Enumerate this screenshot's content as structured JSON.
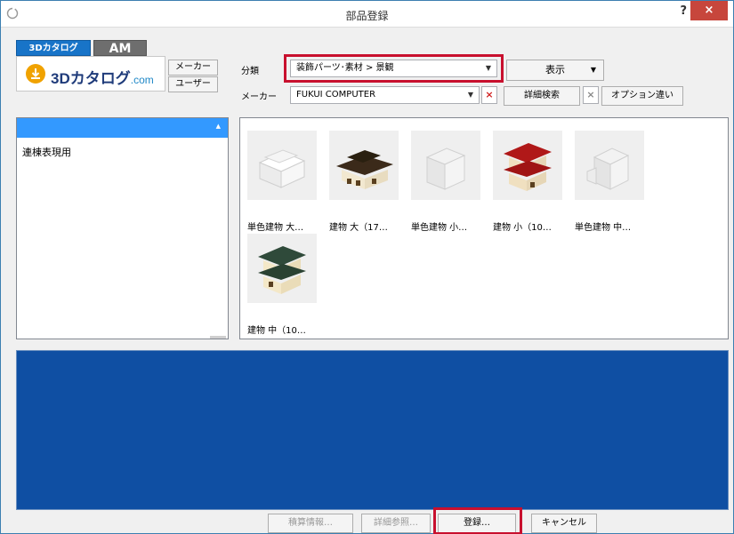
{
  "window": {
    "title": "部品登録",
    "help": "?",
    "close": "×"
  },
  "tabs": {
    "catalog3d": "3Dカタログ",
    "am": "AM"
  },
  "logo": {
    "main": "3Dカタログ",
    "suffix": ".com"
  },
  "source_buttons": {
    "maker": "メーカー",
    "user": "ユーザー"
  },
  "filters": {
    "category_label": "分類",
    "category_value": "装飾パーツ･素材 > 景観",
    "maker_label": "メーカー",
    "maker_value": "FUKUI COMPUTER"
  },
  "toolbar": {
    "display": "表示",
    "detail_search": "詳細検索",
    "option_diff": "オプション違い",
    "clear": "×"
  },
  "left_list": {
    "items": [
      "連棟表現用"
    ]
  },
  "thumbnails": [
    {
      "caption": "単色建物 大…",
      "color": "#e8e8e8"
    },
    {
      "caption": "建物 大（17…",
      "color": "#5a4a30"
    },
    {
      "caption": "単色建物 小…",
      "color": "#e8e8e8"
    },
    {
      "caption": "建物 小（10…",
      "color": "#b01818"
    },
    {
      "caption": "単色建物 中…",
      "color": "#e8e8e8"
    },
    {
      "caption": "建物 中（10…",
      "color": "#2f4a3a"
    }
  ],
  "bottom": {
    "estimate": "積算情報…",
    "detail_ref": "詳細参照…",
    "register": "登録…",
    "cancel": "キャンセル"
  },
  "colors": {
    "accent": "#1874c8",
    "highlight": "#c8102e",
    "preview_bg": "#0f4fa3"
  }
}
